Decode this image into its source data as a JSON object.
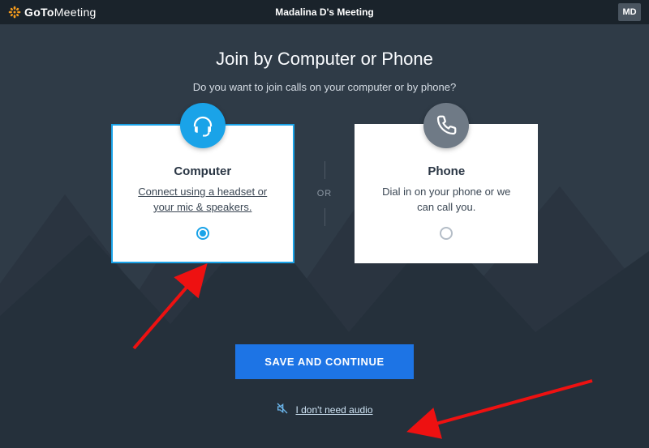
{
  "brand": {
    "bold": "GoTo",
    "light": "Meeting"
  },
  "header": {
    "title": "Madalina D's Meeting",
    "user_initials": "MD"
  },
  "page": {
    "title": "Join by Computer or Phone",
    "subtitle": "Do you want to join calls on your computer or by phone?",
    "or_label": "OR"
  },
  "options": {
    "computer": {
      "title": "Computer",
      "desc": "Connect using a headset or your mic & speakers.",
      "selected": true
    },
    "phone": {
      "title": "Phone",
      "desc": "Dial in on your phone or we can call you.",
      "selected": false
    }
  },
  "actions": {
    "save_continue": "SAVE AND CONTINUE",
    "no_audio": "I don't need audio"
  },
  "colors": {
    "accent": "#1aa3e8",
    "primary_button": "#1d74e5",
    "header_bg": "#1a232b",
    "body_bg": "#2f3b47"
  }
}
